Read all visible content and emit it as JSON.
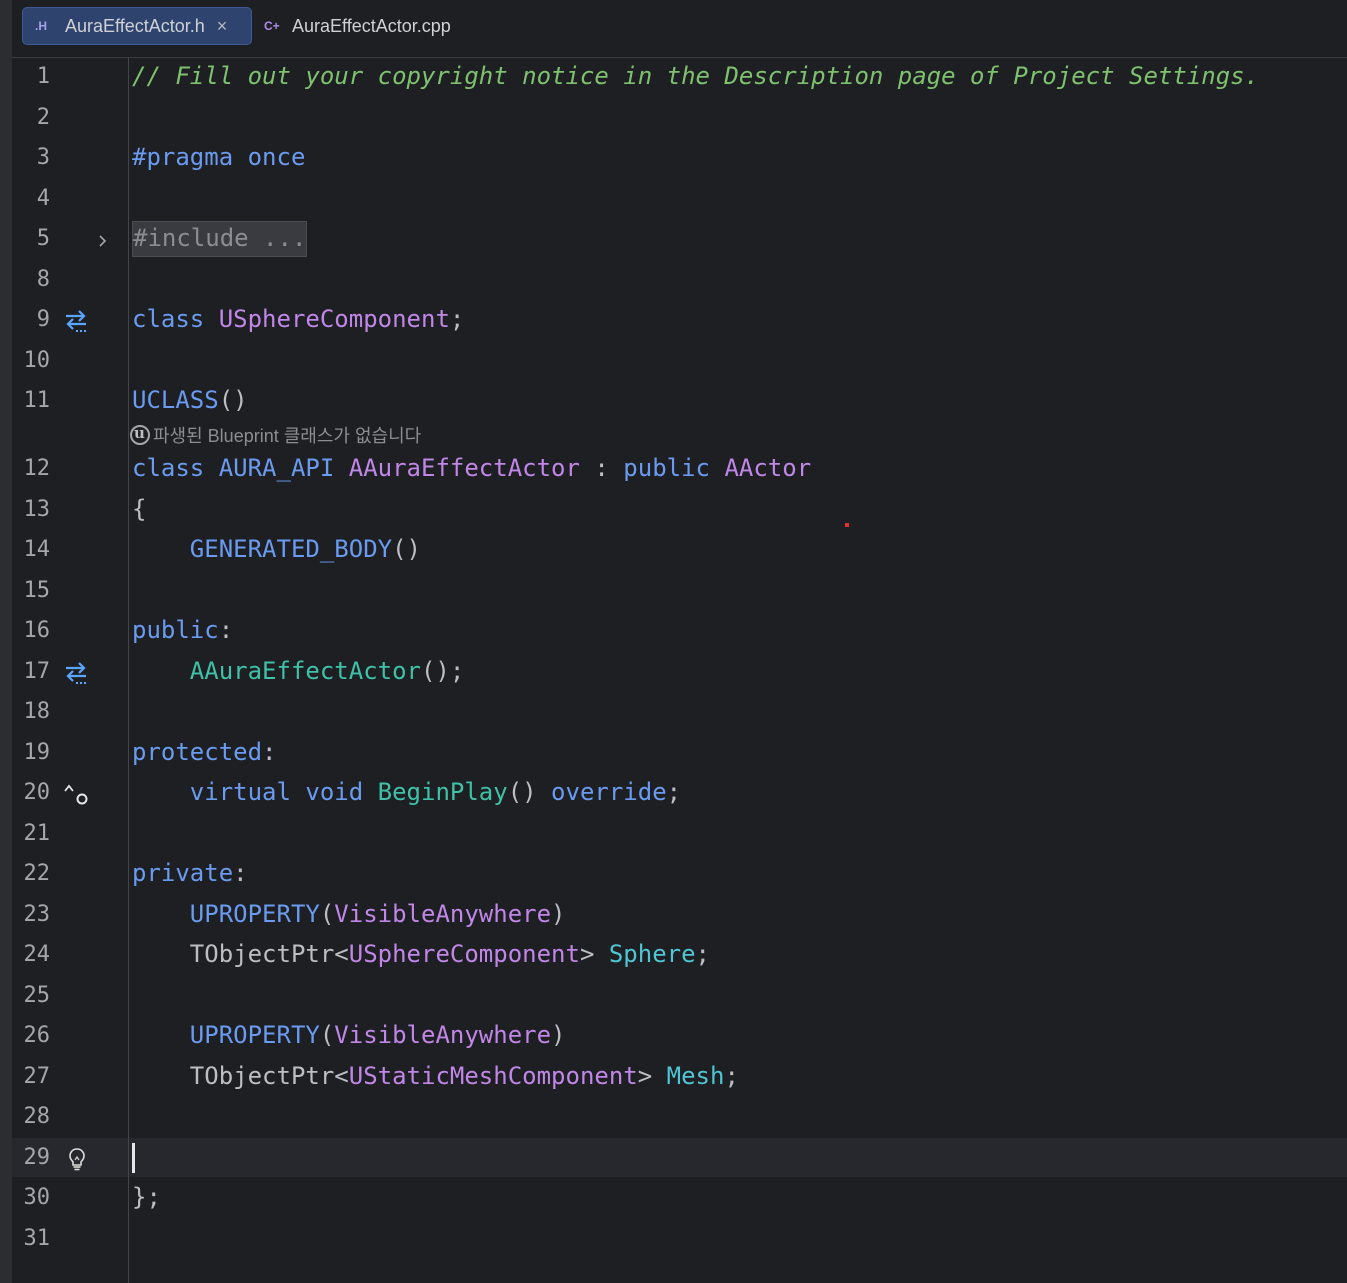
{
  "tabs": [
    {
      "icon": ".H",
      "label": "AuraEffectActor.h",
      "close": "×",
      "active": true
    },
    {
      "icon": "C+",
      "label": "AuraEffectActor.cpp",
      "active": false
    }
  ],
  "editor": {
    "lines": {
      "l1": {
        "num": "1",
        "comment": "// Fill out your copyright notice in the Description page of Project Settings."
      },
      "l2": {
        "num": "2"
      },
      "l3": {
        "num": "3",
        "kw": "#pragma once"
      },
      "l4": {
        "num": "4"
      },
      "l5": {
        "num": "5",
        "folded": "#include ..."
      },
      "l8": {
        "num": "8"
      },
      "l9": {
        "num": "9",
        "kw": "class ",
        "type": "USphereComponent",
        "punct": ";"
      },
      "l10": {
        "num": "10"
      },
      "l11": {
        "num": "11",
        "macro": "UCLASS",
        "parens": "()"
      },
      "l12": {
        "num": "12",
        "kw1": "class ",
        "api": "AURA_API ",
        "type1": "AAuraEffectActor",
        "punct": " : ",
        "kw2": "public ",
        "type2": "AActor"
      },
      "l13": {
        "num": "13",
        "plain": "{"
      },
      "l14": {
        "num": "14",
        "macro": "GENERATED_BODY",
        "parens": "()"
      },
      "l15": {
        "num": "15"
      },
      "l16": {
        "num": "16",
        "kw": "public",
        "punct": ":"
      },
      "l17": {
        "num": "17",
        "fn": "AAuraEffectActor",
        "punct": "();"
      },
      "l18": {
        "num": "18"
      },
      "l19": {
        "num": "19",
        "kw": "protected",
        "punct": ":"
      },
      "l20": {
        "num": "20",
        "kw1": "virtual void ",
        "fn": "BeginPlay",
        "parens": "() ",
        "kw2": "override",
        "punct": ";"
      },
      "l21": {
        "num": "21"
      },
      "l22": {
        "num": "22",
        "kw": "private",
        "punct": ":"
      },
      "l23": {
        "num": "23",
        "macro": "UPROPERTY",
        "open": "(",
        "type": "VisibleAnywhere",
        "close": ")"
      },
      "l24": {
        "num": "24",
        "plain": "TObjectPtr",
        "lt": "<",
        "type": "USphereComponent",
        "gt": "> ",
        "field": "Sphere",
        "punct": ";"
      },
      "l25": {
        "num": "25"
      },
      "l26": {
        "num": "26",
        "macro": "UPROPERTY",
        "open": "(",
        "type": "VisibleAnywhere",
        "close": ")"
      },
      "l27": {
        "num": "27",
        "plain": "TObjectPtr",
        "lt": "<",
        "type": "UStaticMeshComponent",
        "gt": "> ",
        "field": "Mesh",
        "punct": ";"
      },
      "l28": {
        "num": "28"
      },
      "l29": {
        "num": "29"
      },
      "l30": {
        "num": "30",
        "plain": "};"
      },
      "l31": {
        "num": "31"
      }
    },
    "inlay_hint": "파생된 Blueprint 클래스가 없습니다",
    "gutter_icons": {
      "l5": "fold-chevron-icon",
      "l9": "navigate-related-icon",
      "l17": "navigate-related-icon",
      "l20": "override-icon",
      "l29": "lightbulb-icon"
    },
    "colors": {
      "keyword": "#6a9bf0",
      "type": "#c086e8",
      "function": "#3fc1a8",
      "comment": "#7ec16f",
      "field": "#4fc6d4",
      "tab_active_bg": "#2e436e"
    }
  }
}
